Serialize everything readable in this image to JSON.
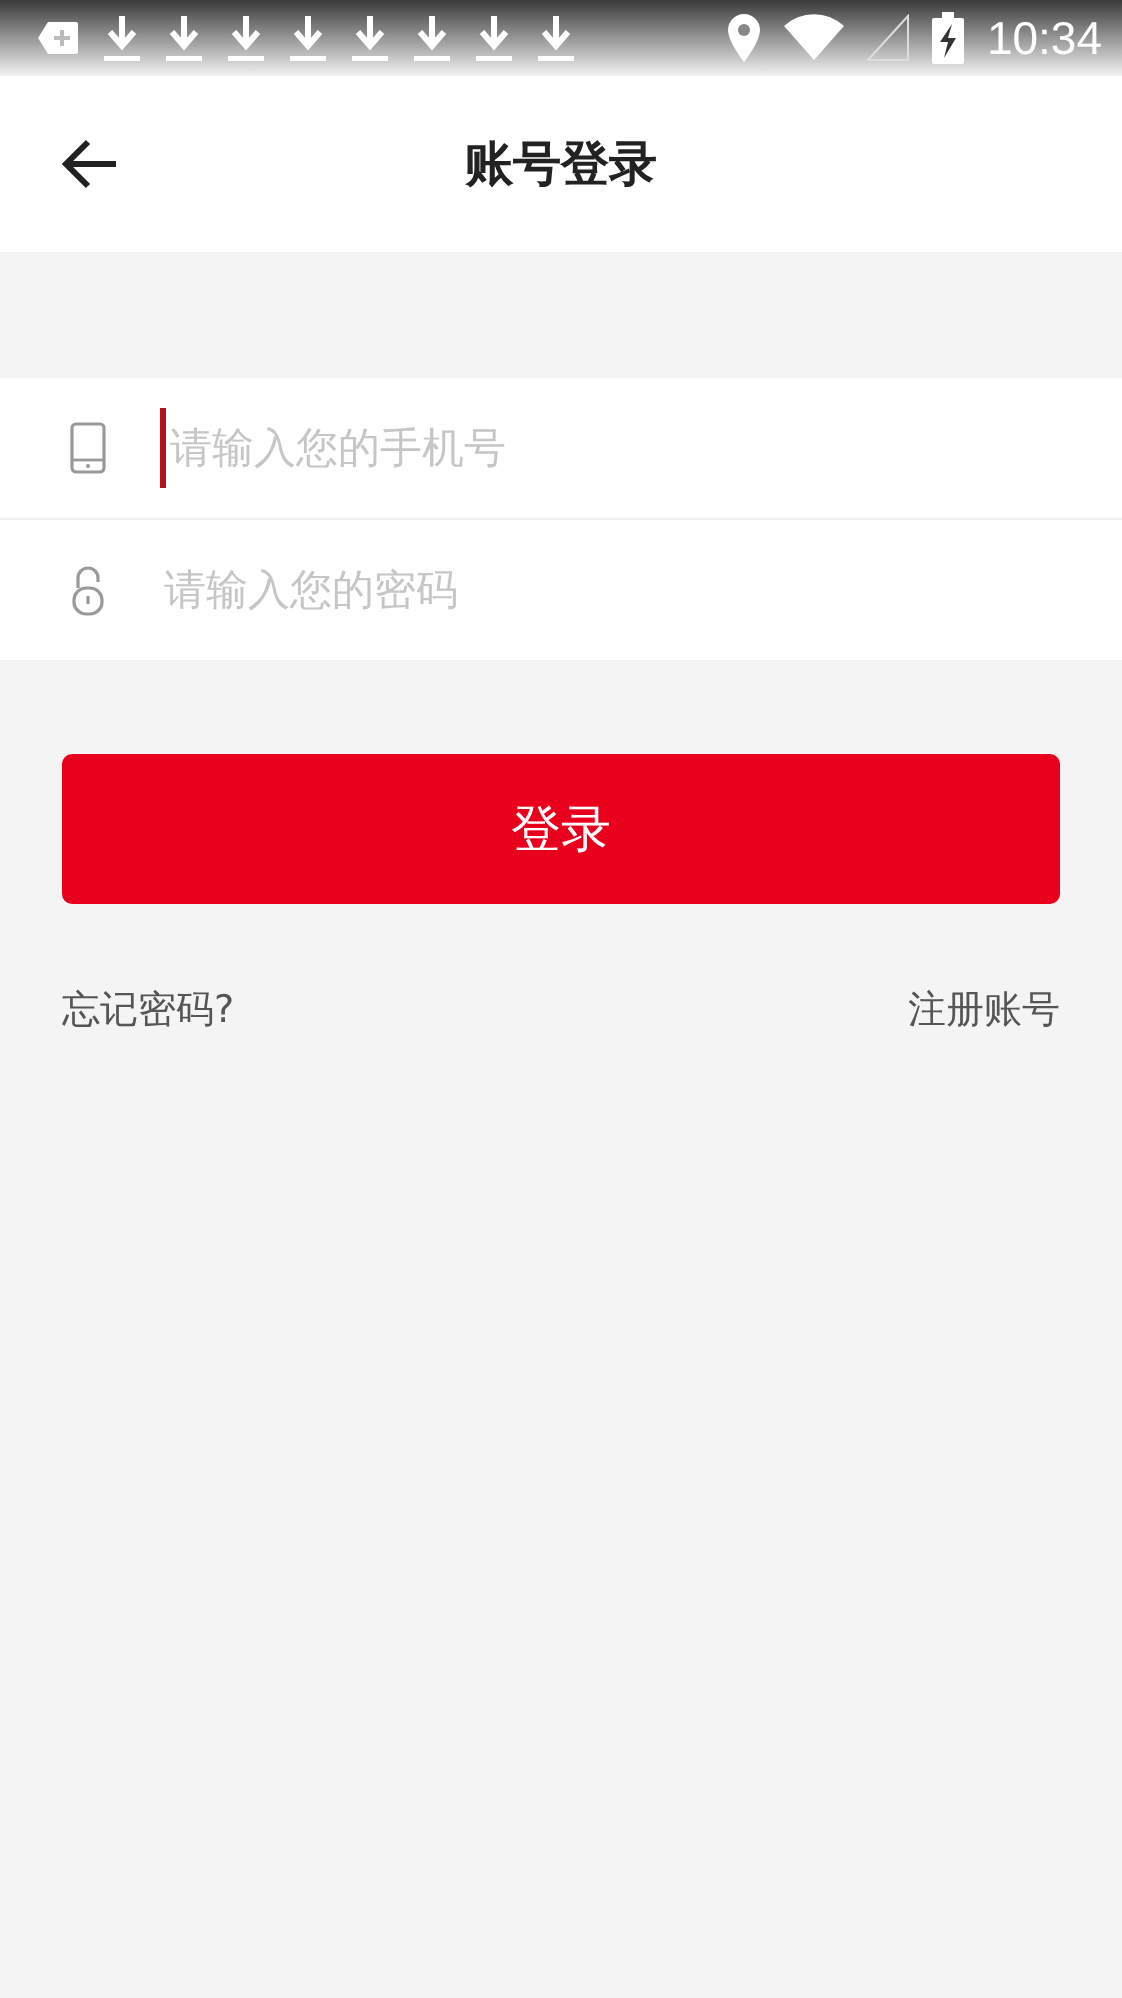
{
  "status_bar": {
    "time": "10:34"
  },
  "header": {
    "title": "账号登录"
  },
  "fields": [
    {
      "kind": "phone",
      "placeholder": "请输入您的手机号",
      "focused": true
    },
    {
      "kind": "password",
      "placeholder": "请输入您的密码",
      "focused": false
    }
  ],
  "login_button": "登录",
  "links": {
    "forgot": "忘记密码?",
    "register": "注册账号"
  }
}
